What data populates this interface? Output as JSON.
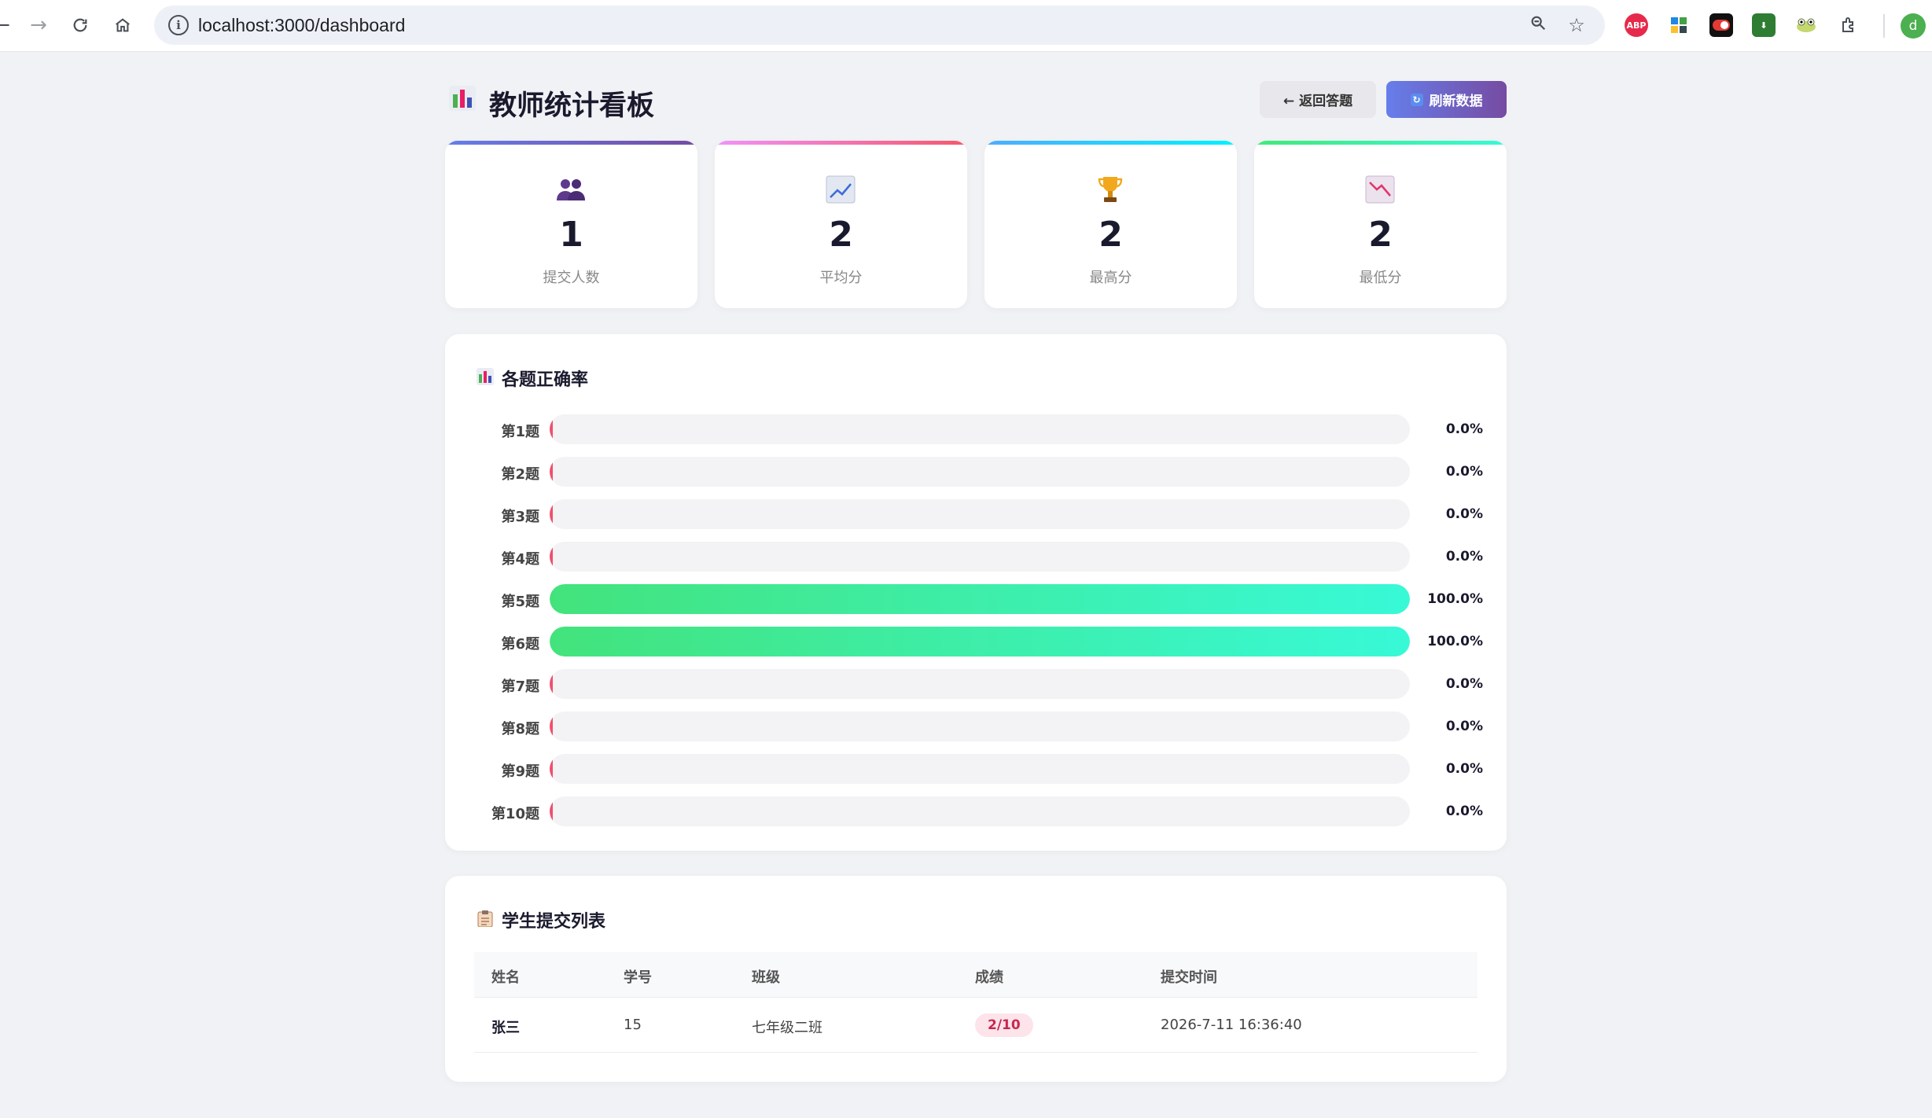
{
  "browser": {
    "url": "localhost:3000/dashboard",
    "profile_initial": "d",
    "extensions": [
      "adblock-icon",
      "puzzle-grid-icon",
      "toggle-icon",
      "download-icon",
      "frog-icon",
      "extensions-icon"
    ]
  },
  "header": {
    "title": "教师统计看板",
    "back_label": "← 返回答题",
    "refresh_label": "刷新数据"
  },
  "stats": [
    {
      "value": "1",
      "label": "提交人数",
      "icon": "users-icon",
      "color": "#764ba2"
    },
    {
      "value": "2",
      "label": "平均分",
      "icon": "chart-up-icon",
      "color": "#f5576c"
    },
    {
      "value": "2",
      "label": "最高分",
      "icon": "trophy-icon",
      "color": "#4facfe"
    },
    {
      "value": "2",
      "label": "最低分",
      "icon": "chart-down-icon",
      "color": "#43e97b"
    }
  ],
  "accuracy": {
    "title": "各题正确率",
    "questions": [
      {
        "label": "第1题",
        "pct": 0,
        "pct_text": "0.0%"
      },
      {
        "label": "第2题",
        "pct": 0,
        "pct_text": "0.0%"
      },
      {
        "label": "第3题",
        "pct": 0,
        "pct_text": "0.0%"
      },
      {
        "label": "第4题",
        "pct": 0,
        "pct_text": "0.0%"
      },
      {
        "label": "第5题",
        "pct": 100,
        "pct_text": "100.0%"
      },
      {
        "label": "第6题",
        "pct": 100,
        "pct_text": "100.0%"
      },
      {
        "label": "第7题",
        "pct": 0,
        "pct_text": "0.0%"
      },
      {
        "label": "第8题",
        "pct": 0,
        "pct_text": "0.0%"
      },
      {
        "label": "第9题",
        "pct": 0,
        "pct_text": "0.0%"
      },
      {
        "label": "第10题",
        "pct": 0,
        "pct_text": "0.0%"
      }
    ]
  },
  "submissions": {
    "title": "学生提交列表",
    "columns": [
      "姓名",
      "学号",
      "班级",
      "成绩",
      "提交时间"
    ],
    "rows": [
      {
        "name": "张三",
        "id": "15",
        "class": "七年级二班",
        "score": "2/10",
        "time": "2026-7-11 16:36:40"
      }
    ]
  }
}
